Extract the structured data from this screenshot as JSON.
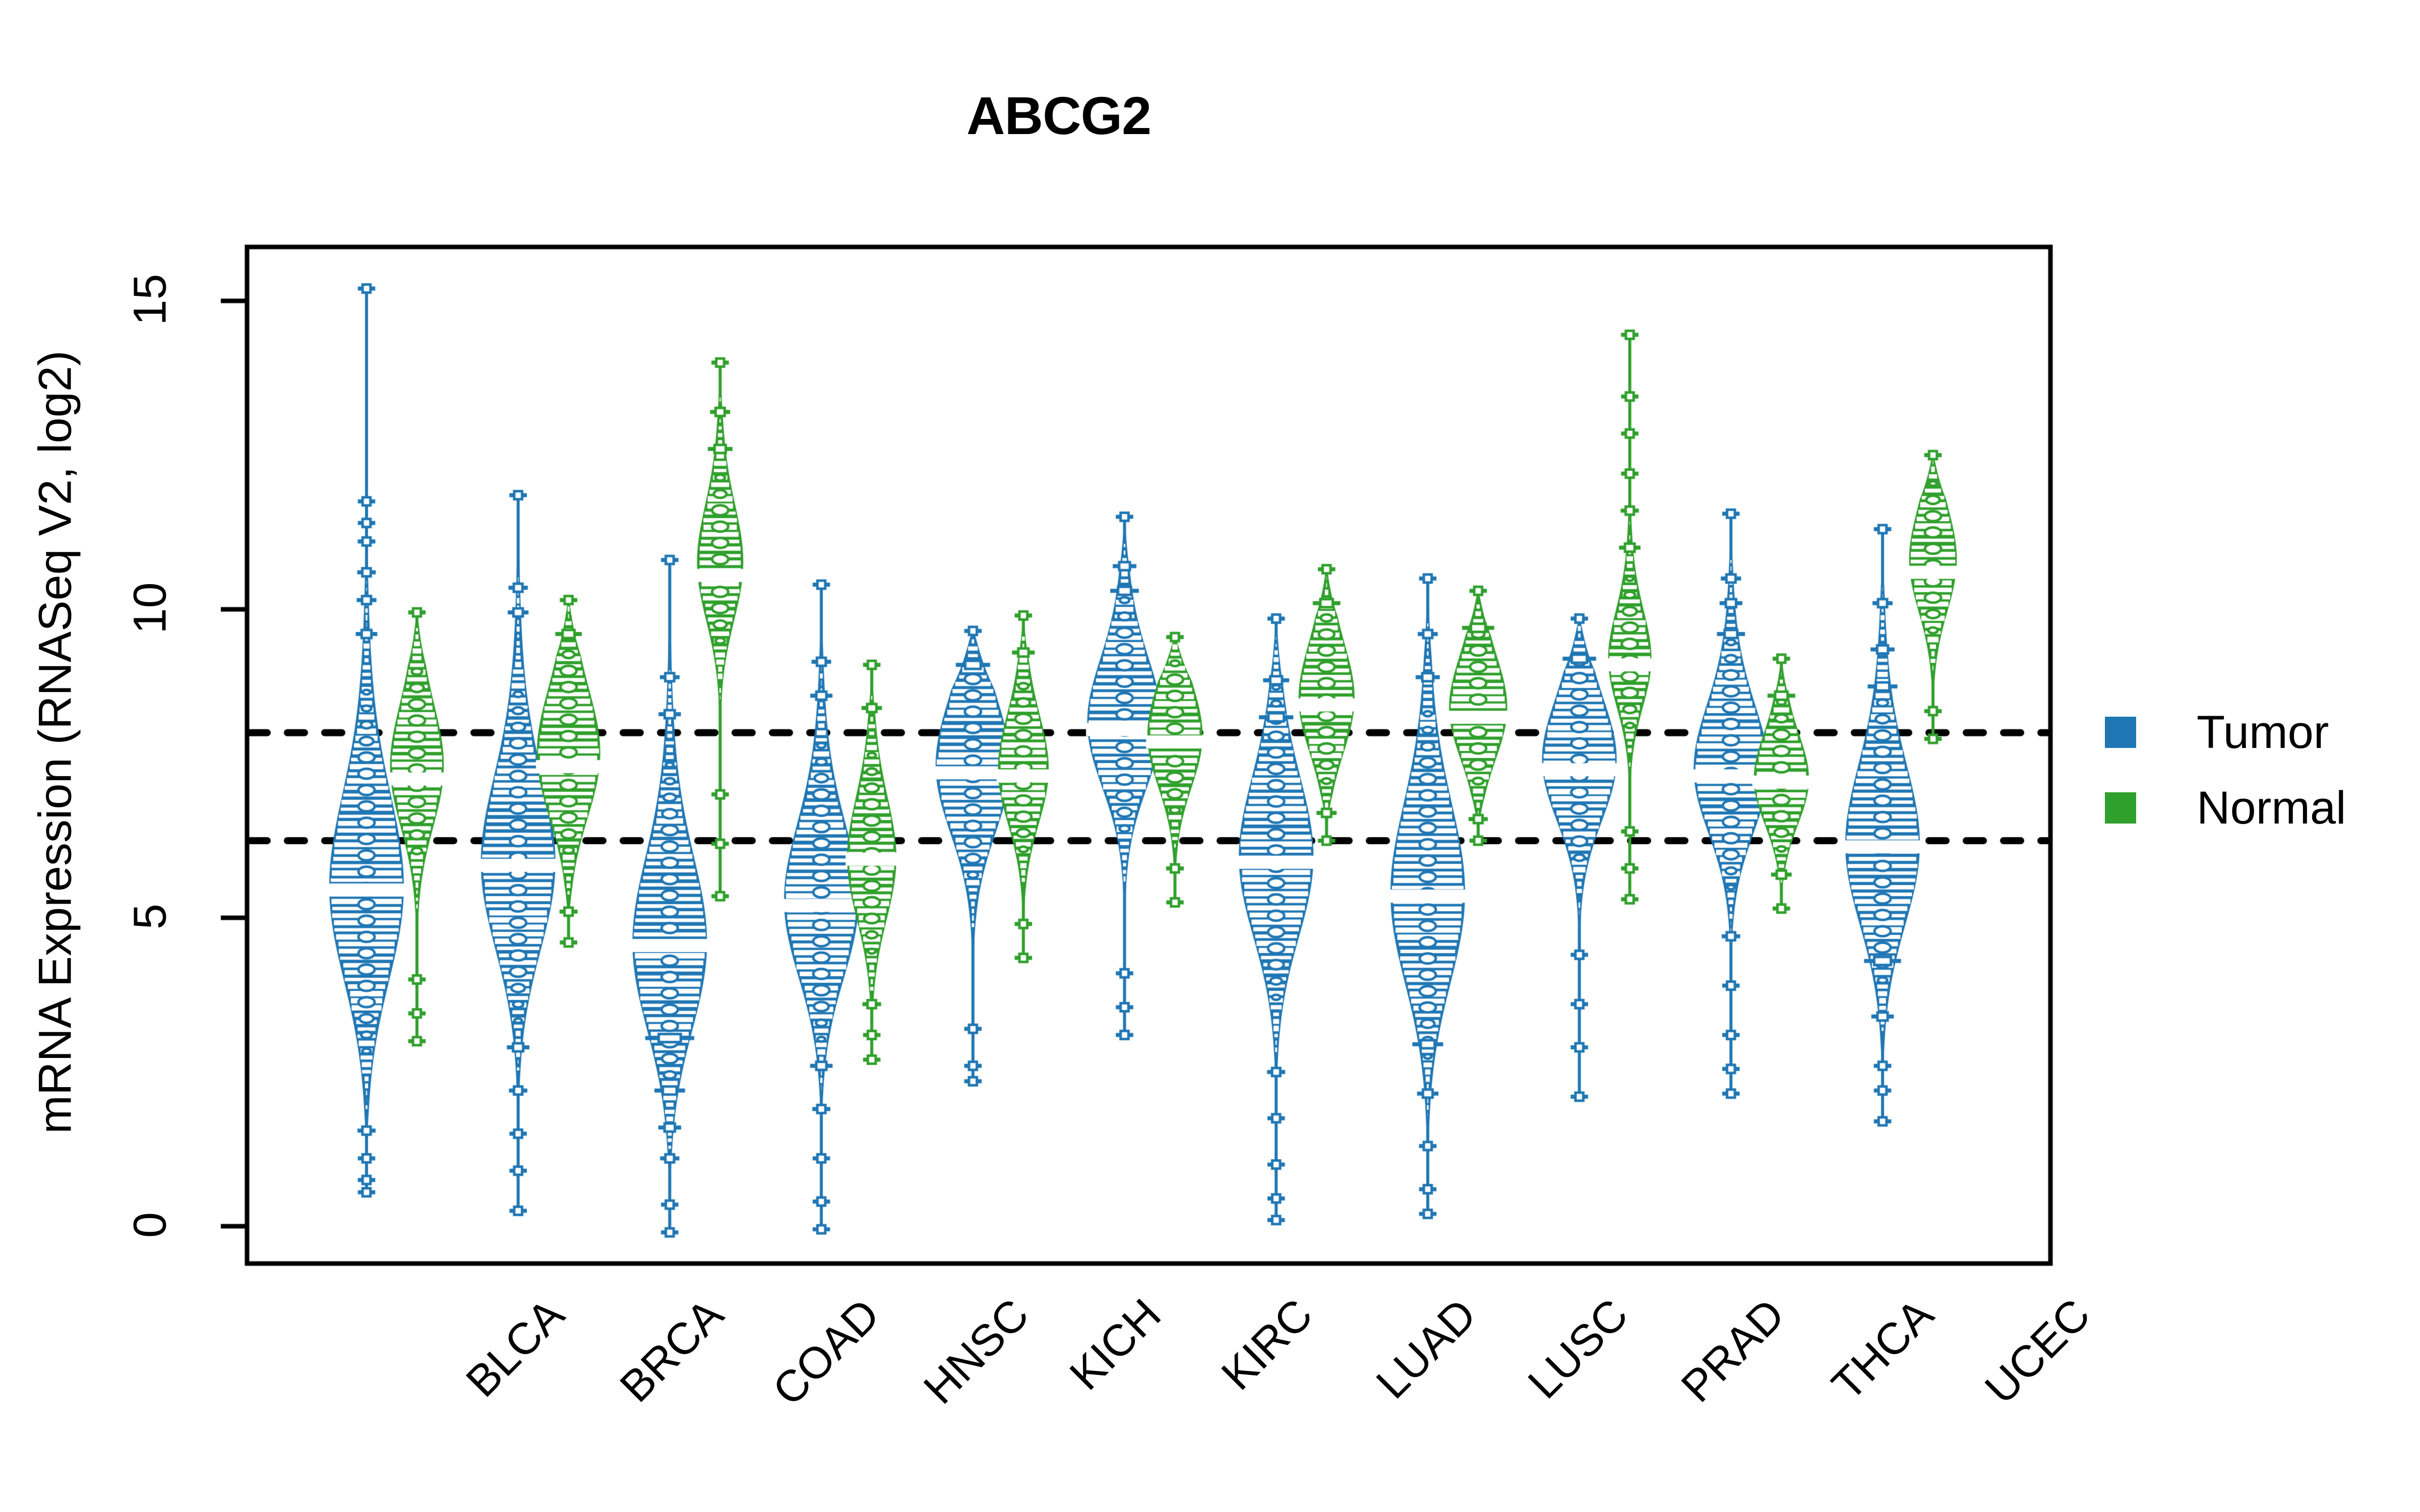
{
  "chart_data": {
    "type": "violin",
    "title": "ABCG2",
    "xlabel": "",
    "ylabel": "mRNA Expression (RNASeq V2, log2)",
    "ylim": [
      -0.95,
      15.9
    ],
    "yticks": [
      0,
      5,
      10,
      15
    ],
    "ytick_labels": [
      "0",
      "5",
      "10",
      "15"
    ],
    "grid": false,
    "reference_lines": [
      8.0,
      6.25
    ],
    "legend_position": "right",
    "legend": [
      {
        "name": "Tumor",
        "color": "#2077b4"
      },
      {
        "name": "Normal",
        "color": "#30a02c"
      }
    ],
    "categories": [
      "BLCA",
      "BRCA",
      "COAD",
      "HNSC",
      "KICH",
      "KIRC",
      "LUAD",
      "LUSC",
      "PRAD",
      "THCA",
      "UCEC"
    ],
    "series": [
      {
        "name": "Tumor",
        "color": "#2077b4",
        "distributions": [
          {
            "category": "BLCA",
            "median": 5.45,
            "q1": 4.35,
            "q3": 6.45,
            "min": 0.55,
            "max": 15.2,
            "width_scale": 1.0,
            "density_peak": 5.4,
            "spread": 1.45,
            "outliers": [
              15.2,
              11.75,
              11.4,
              11.1,
              10.6,
              10.15,
              9.6,
              1.55,
              1.1,
              0.75,
              0.55
            ]
          },
          {
            "category": "BRCA",
            "median": 5.85,
            "q1": 4.6,
            "q3": 6.75,
            "min": 0.25,
            "max": 11.85,
            "width_scale": 1.0,
            "density_peak": 5.8,
            "spread": 1.35,
            "outliers": [
              11.85,
              10.35,
              9.95,
              2.9,
              2.2,
              1.5,
              0.9,
              0.25
            ]
          },
          {
            "category": "COAD",
            "median": 4.55,
            "q1": 3.5,
            "q3": 5.55,
            "min": -0.1,
            "max": 10.8,
            "width_scale": 1.0,
            "density_peak": 4.5,
            "spread": 1.35,
            "outliers": [
              10.8,
              8.9,
              8.3,
              3.05,
              2.2,
              1.6,
              1.1,
              0.35,
              -0.1
            ]
          },
          {
            "category": "HNSC",
            "median": 5.2,
            "q1": 4.3,
            "q3": 6.1,
            "min": -0.05,
            "max": 10.4,
            "width_scale": 1.0,
            "density_peak": 5.2,
            "spread": 1.2,
            "outliers": [
              10.4,
              9.15,
              8.6,
              2.6,
              1.9,
              1.1,
              0.4,
              -0.05
            ]
          },
          {
            "category": "KICH",
            "median": 7.35,
            "q1": 6.55,
            "q3": 8.0,
            "min": 2.35,
            "max": 9.65,
            "width_scale": 1.0,
            "density_peak": 7.4,
            "spread": 1.05,
            "outliers": [
              9.65,
              9.1,
              3.2,
              2.6,
              2.35
            ]
          },
          {
            "category": "KIRC",
            "median": 8.05,
            "q1": 7.35,
            "q3": 8.8,
            "min": 3.1,
            "max": 11.5,
            "width_scale": 1.0,
            "density_peak": 8.1,
            "spread": 1.0,
            "outliers": [
              11.5,
              10.7,
              10.3,
              4.1,
              3.55,
              3.1
            ]
          },
          {
            "category": "LUAD",
            "median": 5.9,
            "q1": 5.0,
            "q3": 6.8,
            "min": 0.1,
            "max": 9.85,
            "width_scale": 1.0,
            "density_peak": 5.9,
            "spread": 1.25,
            "outliers": [
              9.85,
              8.85,
              8.25,
              2.5,
              1.75,
              1.0,
              0.45,
              0.1
            ]
          },
          {
            "category": "LUSC",
            "median": 5.35,
            "q1": 4.35,
            "q3": 6.45,
            "min": 0.2,
            "max": 10.5,
            "width_scale": 1.0,
            "density_peak": 5.3,
            "spread": 1.4,
            "outliers": [
              10.5,
              9.6,
              8.9,
              2.95,
              2.15,
              1.3,
              0.6,
              0.2
            ]
          },
          {
            "category": "PRAD",
            "median": 7.4,
            "q1": 6.75,
            "q3": 8.0,
            "min": 2.1,
            "max": 9.85,
            "width_scale": 1.0,
            "density_peak": 7.5,
            "spread": 0.95,
            "outliers": [
              9.85,
              9.2,
              4.4,
              3.6,
              2.9,
              2.1
            ]
          },
          {
            "category": "THCA",
            "median": 7.3,
            "q1": 6.6,
            "q3": 8.0,
            "min": 2.15,
            "max": 11.55,
            "width_scale": 1.0,
            "density_peak": 7.35,
            "spread": 1.0,
            "outliers": [
              11.55,
              10.5,
              10.1,
              9.6,
              4.7,
              3.9,
              3.1,
              2.55,
              2.15
            ]
          },
          {
            "category": "UCEC",
            "median": 6.15,
            "q1": 5.3,
            "q3": 7.15,
            "min": 1.7,
            "max": 11.3,
            "width_scale": 1.0,
            "density_peak": 6.1,
            "spread": 1.25,
            "outliers": [
              11.3,
              10.1,
              9.35,
              8.75,
              4.3,
              3.4,
              2.6,
              2.2,
              1.7
            ]
          }
        ]
      },
      {
        "name": "Normal",
        "color": "#30a02c",
        "distributions": [
          {
            "category": "BLCA",
            "median": 7.25,
            "q1": 6.3,
            "q3": 8.05,
            "min": 3.0,
            "max": 9.95,
            "width_scale": 0.72,
            "density_peak": 7.4,
            "spread": 0.95,
            "outliers": [
              9.95,
              4.0,
              3.45,
              3.0
            ]
          },
          {
            "category": "BRCA",
            "median": 7.45,
            "q1": 6.6,
            "q3": 8.4,
            "min": 4.6,
            "max": 10.15,
            "width_scale": 0.85,
            "density_peak": 7.6,
            "spread": 1.0,
            "outliers": [
              10.15,
              9.6,
              5.1,
              4.6
            ]
          },
          {
            "category": "COAD",
            "median": 10.55,
            "q1": 9.85,
            "q3": 11.15,
            "min": 5.35,
            "max": 14.0,
            "width_scale": 0.62,
            "density_peak": 10.7,
            "spread": 0.9,
            "outliers": [
              14.0,
              13.2,
              12.6,
              7.0,
              6.2,
              5.35
            ]
          },
          {
            "category": "HNSC",
            "median": 5.95,
            "q1": 5.25,
            "q3": 6.6,
            "min": 2.7,
            "max": 9.1,
            "width_scale": 0.66,
            "density_peak": 5.9,
            "spread": 0.95,
            "outliers": [
              9.1,
              8.4,
              3.6,
              3.1,
              2.7
            ]
          },
          {
            "category": "KICH",
            "median": 7.3,
            "q1": 6.75,
            "q3": 8.05,
            "min": 4.35,
            "max": 9.9,
            "width_scale": 0.68,
            "density_peak": 7.35,
            "spread": 0.85,
            "outliers": [
              9.9,
              9.3,
              4.9,
              4.35
            ]
          },
          {
            "category": "KIRC",
            "median": 7.85,
            "q1": 7.15,
            "q3": 8.45,
            "min": 5.25,
            "max": 9.55,
            "width_scale": 0.74,
            "density_peak": 7.9,
            "spread": 0.8,
            "outliers": [
              9.55,
              5.8,
              5.25
            ]
          },
          {
            "category": "LUAD",
            "median": 8.45,
            "q1": 7.8,
            "q3": 9.1,
            "min": 6.25,
            "max": 10.65,
            "width_scale": 0.75,
            "density_peak": 8.5,
            "spread": 0.85,
            "outliers": [
              10.65,
              10.1,
              6.7,
              6.25
            ]
          },
          {
            "category": "LUSC",
            "median": 8.25,
            "q1": 7.6,
            "q3": 8.85,
            "min": 6.25,
            "max": 10.3,
            "width_scale": 0.78,
            "density_peak": 8.35,
            "spread": 0.8,
            "outliers": [
              10.3,
              9.7,
              6.6,
              6.25
            ]
          },
          {
            "category": "PRAD",
            "median": 9.1,
            "q1": 8.6,
            "q3": 9.65,
            "min": 5.3,
            "max": 14.45,
            "width_scale": 0.58,
            "density_peak": 9.15,
            "spread": 0.75,
            "outliers": [
              14.45,
              13.45,
              12.85,
              12.2,
              11.6,
              11.0,
              6.4,
              5.8,
              5.3
            ]
          },
          {
            "category": "THCA",
            "median": 7.2,
            "q1": 6.75,
            "q3": 7.7,
            "min": 5.15,
            "max": 9.2,
            "width_scale": 0.74,
            "density_peak": 7.2,
            "spread": 0.7,
            "outliers": [
              9.2,
              8.6,
              5.7,
              5.15
            ]
          },
          {
            "category": "UCEC",
            "median": 10.6,
            "q1": 9.9,
            "q3": 11.25,
            "min": 7.9,
            "max": 12.5,
            "width_scale": 0.64,
            "density_peak": 10.75,
            "spread": 0.8,
            "outliers": [
              12.5,
              8.35,
              7.9
            ]
          }
        ]
      }
    ]
  },
  "title": {
    "text": "ABCG2"
  },
  "axes": {
    "y_title": "mRNA Expression (RNASeq V2, log2)",
    "y_tick_labels": [
      "15",
      "10",
      "5",
      "0"
    ],
    "x_tick_labels": [
      "BLCA",
      "BRCA",
      "COAD",
      "HNSC",
      "KICH",
      "KIRC",
      "LUAD",
      "LUSC",
      "PRAD",
      "THCA",
      "UCEC"
    ]
  },
  "legend": {
    "items": [
      {
        "label": "Tumor",
        "color": "#2077b4"
      },
      {
        "label": "Normal",
        "color": "#30a02c"
      }
    ]
  },
  "colors": {
    "tumor": "#2077b4",
    "normal": "#30a02c",
    "axis": "#000000",
    "background": "#ffffff"
  }
}
